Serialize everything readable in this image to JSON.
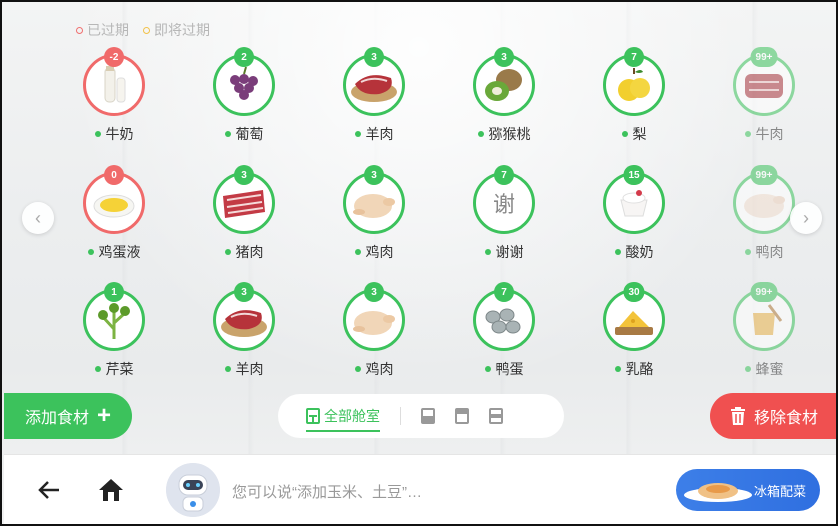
{
  "legend": {
    "expired": "已过期",
    "expiring_soon": "即将过期"
  },
  "colors": {
    "fresh": "#3cc25c",
    "expired": "#f06a6a",
    "soon": "#f2c24a",
    "remove": "#f05050",
    "recipe": "#3d7fe8"
  },
  "items": [
    {
      "name": "牛奶",
      "count": "-2",
      "status": "expired",
      "icon": "milk-bottle-icon"
    },
    {
      "name": "葡萄",
      "count": "2",
      "status": "fresh",
      "icon": "grapes-icon"
    },
    {
      "name": "羊肉",
      "count": "3",
      "status": "fresh",
      "icon": "mutton-icon"
    },
    {
      "name": "猕猴桃",
      "count": "3",
      "status": "fresh",
      "icon": "kiwi-icon"
    },
    {
      "name": "梨",
      "count": "7",
      "status": "fresh",
      "icon": "pear-icon"
    },
    {
      "name": "牛肉",
      "count": "99+",
      "status": "fresh",
      "icon": "beef-icon"
    },
    {
      "name": "鸡蛋液",
      "count": "0",
      "status": "expired",
      "icon": "egg-liquid-icon"
    },
    {
      "name": "猪肉",
      "count": "3",
      "status": "fresh",
      "icon": "pork-icon"
    },
    {
      "name": "鸡肉",
      "count": "3",
      "status": "fresh",
      "icon": "chicken-icon"
    },
    {
      "name": "谢谢",
      "count": "7",
      "status": "fresh",
      "icon": "text-placeholder",
      "thumb_text": "谢"
    },
    {
      "name": "酸奶",
      "count": "15",
      "status": "fresh",
      "icon": "yogurt-icon"
    },
    {
      "name": "鸭肉",
      "count": "99+",
      "status": "fresh",
      "icon": "duck-icon"
    },
    {
      "name": "芹菜",
      "count": "1",
      "status": "fresh",
      "icon": "celery-icon"
    },
    {
      "name": "羊肉",
      "count": "3",
      "status": "fresh",
      "icon": "mutton-icon"
    },
    {
      "name": "鸡肉",
      "count": "3",
      "status": "fresh",
      "icon": "chicken-icon"
    },
    {
      "name": "鸭蛋",
      "count": "7",
      "status": "fresh",
      "icon": "duck-egg-icon"
    },
    {
      "name": "乳酪",
      "count": "30",
      "status": "fresh",
      "icon": "cheese-icon"
    },
    {
      "name": "蜂蜜",
      "count": "99+",
      "status": "fresh",
      "icon": "honey-icon"
    }
  ],
  "actions": {
    "add_label": "添加食材",
    "remove_label": "移除食材"
  },
  "compartments": {
    "all_label": "全部舱室"
  },
  "bottom_bar": {
    "voice_hint": "您可以说“添加玉米、土豆”…",
    "recipe_label": "冰箱配菜"
  }
}
